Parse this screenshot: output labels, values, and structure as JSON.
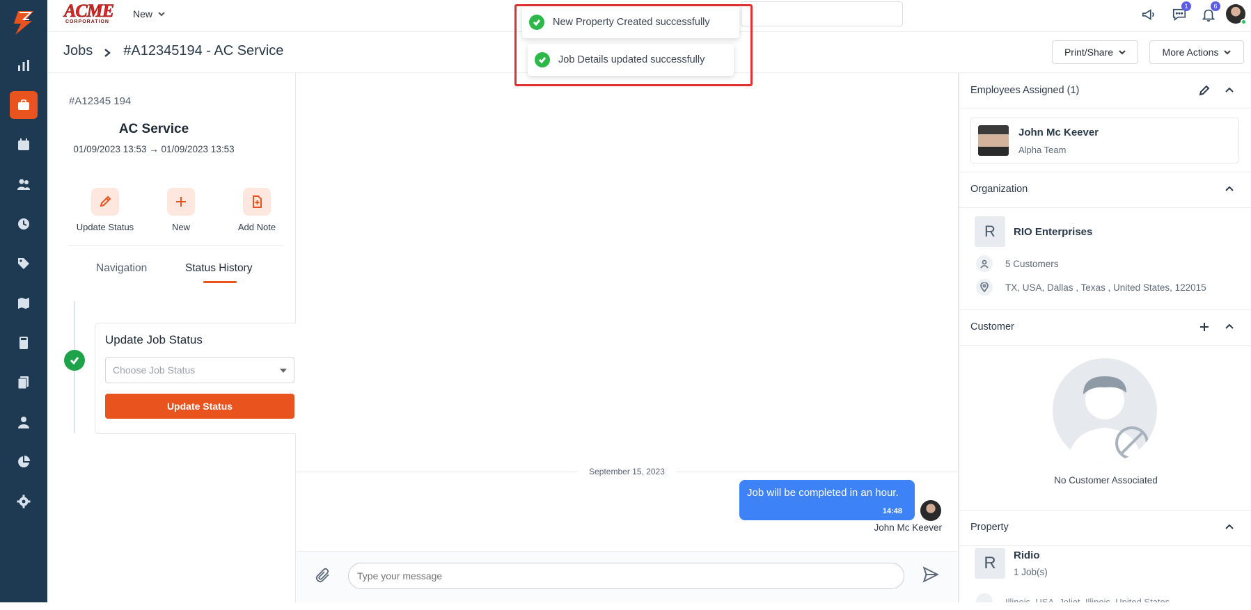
{
  "brand": {
    "name": "ACME",
    "sub": "CORPORATION"
  },
  "topbar": {
    "new_label": "New",
    "chat_badge": "1",
    "notif_badge": "6"
  },
  "breadcrumb": {
    "root": "Jobs",
    "current": "#A12345194 - AC Service"
  },
  "header_actions": {
    "print_share": "Print/Share",
    "more_actions": "More Actions"
  },
  "job": {
    "number": "#A12345 194",
    "title": "AC Service",
    "dates": "01/09/2023 13:53 → 01/09/2023 13:53",
    "actions": [
      {
        "label": "Update Status",
        "icon": "pencil-icon"
      },
      {
        "label": "New",
        "icon": "plus-icon"
      },
      {
        "label": "Add Note",
        "icon": "note-plus-icon"
      }
    ],
    "tabs": [
      "Navigation",
      "Status History"
    ],
    "active_tab": "Status History",
    "status_card": {
      "title": "Update Job Status",
      "select_placeholder": "Choose Job Status",
      "button": "Update Status"
    }
  },
  "chat": {
    "date": "September 15, 2023",
    "messages": [
      {
        "text": "Job will be completed in an hour.",
        "time": "14:48",
        "author": "John Mc Keever"
      }
    ],
    "input_placeholder": "Type your message"
  },
  "right": {
    "employees": {
      "title": "Employees Assigned (1)",
      "name": "John Mc Keever",
      "team": "Alpha Team"
    },
    "organization": {
      "title": "Organization",
      "initial": "R",
      "name": "RIO Enterprises",
      "customers": "5 Customers",
      "address": "TX, USA, Dallas , Texas , United States, 122015"
    },
    "customer": {
      "title": "Customer",
      "empty": "No Customer Associated"
    },
    "property": {
      "title": "Property",
      "initial": "R",
      "name": "Ridio",
      "jobs": "1 Job(s)",
      "address": "Illinois, USA, Joliet, Illinois, United States"
    }
  },
  "toasts": [
    "New Property Created successfully",
    "Job Details updated successfully"
  ],
  "colors": {
    "accent": "#e9531e",
    "sidebar": "#1e3a53",
    "bubble": "#3d82f6",
    "success": "#2fb84a",
    "highlight": "#e03131"
  }
}
